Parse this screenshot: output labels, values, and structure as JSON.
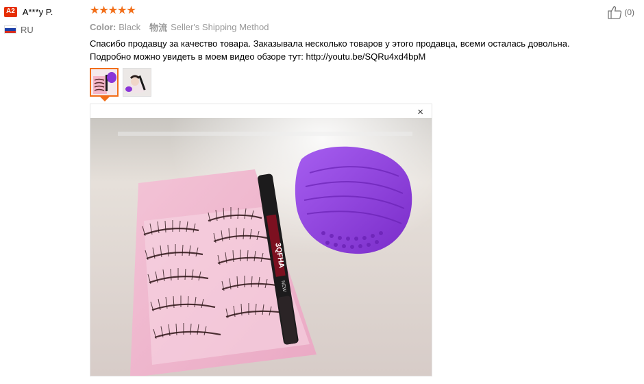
{
  "user": {
    "level_badge": "A2",
    "name": "A***y P.",
    "country_code": "RU",
    "flag_colors": [
      "#ffffff",
      "#1c3fa8",
      "#d52b1e"
    ]
  },
  "review": {
    "rating": 5,
    "star_color": "#f26e18",
    "color_label": "Color:",
    "color_value": "Black",
    "shipping_label": "物流",
    "shipping_value": "Seller's Shipping Method",
    "text_line1": "Спасибо продавцу за качество товара. Заказывала несколько товаров у этого продавца, всеми осталась довольна.",
    "text_line2": "Подробно можно увидеть в моем видео обзоре тут: http://youtu.be/SQRu4xd4bpM"
  },
  "photos": {
    "thumbnails": [
      {
        "name": "eyelashes-thumbnail",
        "selected": true
      },
      {
        "name": "eyeliner-thumbnail",
        "selected": false
      }
    ],
    "close_icon": "×",
    "eyeliner_text": "3QFHA",
    "eyeliner_text2": "NEW"
  },
  "helpful": {
    "icon": "thumbs-up-icon",
    "count": "(0)"
  }
}
